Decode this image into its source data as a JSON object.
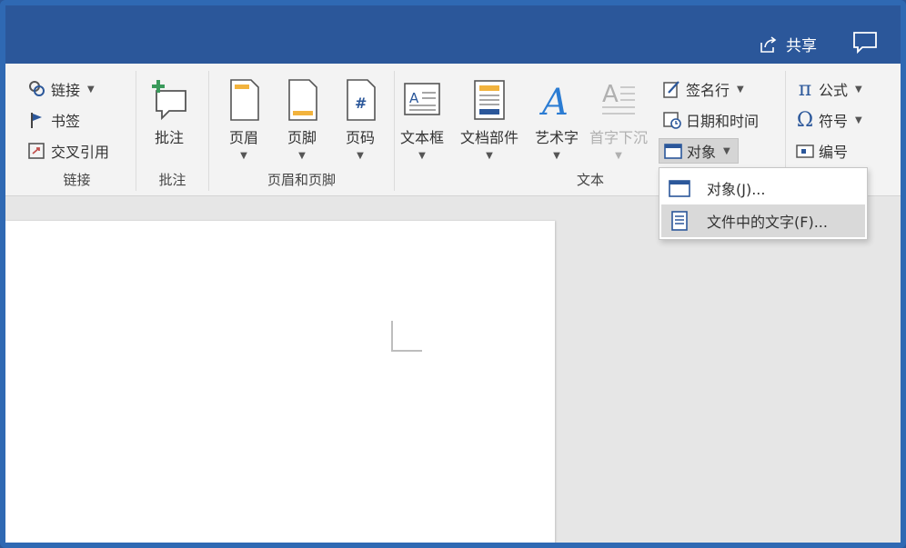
{
  "titlebar": {
    "share_label": "共享"
  },
  "ribbon": {
    "links_group": {
      "label": "链接",
      "link": "链接",
      "bookmark": "书签",
      "cross_ref": "交叉引用"
    },
    "comments_group": {
      "label": "批注",
      "comment": "批注"
    },
    "header_footer_group": {
      "label": "页眉和页脚",
      "header": "页眉",
      "footer": "页脚",
      "page_number": "页码"
    },
    "text_group": {
      "label": "文本",
      "text_box": "文本框",
      "quick_parts": "文档部件",
      "wordart": "艺术字",
      "drop_cap": "首字下沉",
      "signature_line": "签名行",
      "date_time": "日期和时间",
      "object": "对象"
    },
    "symbols_group": {
      "equation": "公式",
      "symbol": "符号",
      "number": "编号"
    }
  },
  "dropdown": {
    "items": [
      "对象(J)...",
      "文件中的文字(F)..."
    ]
  },
  "colors": {
    "title_bar": "#2b579a",
    "ribbon": "#f3f3f3",
    "accent": "#2b579a"
  }
}
